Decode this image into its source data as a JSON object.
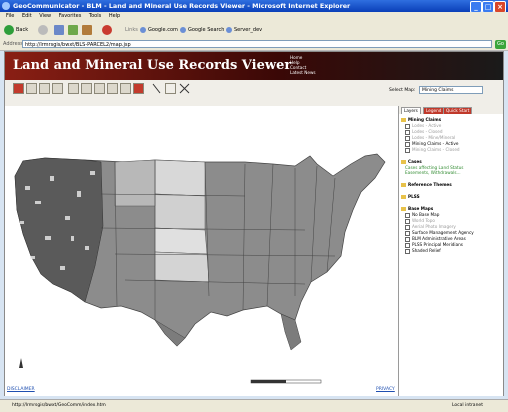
{
  "window": {
    "title": "GeoCommunicator - BLM - Land and Mineral Use Records Viewer - Microsoft Internet Explorer",
    "min": "_",
    "max": "□",
    "close": "×"
  },
  "menubar": [
    "File",
    "Edit",
    "View",
    "Favorites",
    "Tools",
    "Help"
  ],
  "toolbar": {
    "back": "Back",
    "links_label": "Links",
    "link1": "Google.com",
    "link2": "Google Search",
    "link3": "Server_dev"
  },
  "address": {
    "label": "Address",
    "url": "http://lrmrsgis/bwxt/BLS-PARCEL2/map.jsp",
    "go": "Go"
  },
  "app": {
    "title": "Land and Mineral Use Records Viewer",
    "links": [
      "Home",
      "Help",
      "Contact",
      "Latest News"
    ],
    "select_map_label": "Select Map:",
    "select_map_value": "Mining Claims",
    "disclaimer": "DISCLAIMER",
    "privacy": "PRIVACY"
  },
  "panel": {
    "tabs": [
      "Layers",
      "Legend",
      "Quick Start"
    ],
    "groups": [
      {
        "name": "Mining Claims",
        "items": [
          "Lodes - Active",
          "Lodes - Closed",
          "Lodes - Mine/Mineral",
          "Mining Claims - Active",
          "Mining Claims - Closed"
        ]
      },
      {
        "name": "Cases",
        "items": [
          "Cases affecting Land Status",
          "Easements, Withdrawals..."
        ]
      },
      {
        "name": "Reference Themes",
        "items": []
      },
      {
        "name": "PLSS",
        "items": []
      },
      {
        "name": "Base Maps",
        "items": [
          "No Base Map",
          "World Topo",
          "Aerial Photo Imagery",
          "Surface Management Agency",
          "BLM Administrative Areas",
          "PLSS Principal Meridians",
          "Shaded Relief"
        ]
      }
    ]
  },
  "status": {
    "text": "http://lrmrsgis/bwxt/GeoComm/index.htm",
    "zone": "Local intranet"
  },
  "colors": {
    "title_bar": "#1d56d0",
    "banner": "#5a130d",
    "state_fill": "#8a8a8a",
    "light_state": "#d6d6d6"
  }
}
